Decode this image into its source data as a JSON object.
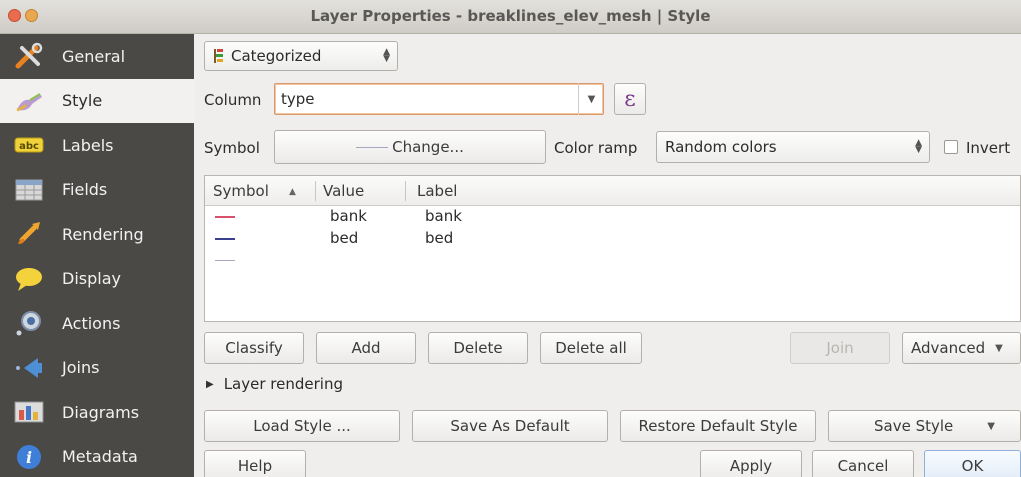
{
  "window": {
    "title": "Layer Properties - breaklines_elev_mesh | Style"
  },
  "sidebar": {
    "items": [
      {
        "label": "General",
        "icon": "tools-icon",
        "active": false
      },
      {
        "label": "Style",
        "icon": "paint-brush-icon",
        "active": true
      },
      {
        "label": "Labels",
        "icon": "abc-label-icon",
        "active": false
      },
      {
        "label": "Fields",
        "icon": "table-fields-icon",
        "active": false
      },
      {
        "label": "Rendering",
        "icon": "paintbrush-rendering-icon",
        "active": false
      },
      {
        "label": "Display",
        "icon": "speech-bubble-icon",
        "active": false
      },
      {
        "label": "Actions",
        "icon": "gear-actions-icon",
        "active": false
      },
      {
        "label": "Joins",
        "icon": "joins-arrow-icon",
        "active": false
      },
      {
        "label": "Diagrams",
        "icon": "diagrams-icon",
        "active": false
      },
      {
        "label": "Metadata",
        "icon": "info-icon",
        "active": false
      }
    ]
  },
  "renderer": {
    "selected": "Categorized"
  },
  "column": {
    "label": "Column",
    "value": "type"
  },
  "symbol": {
    "label": "Symbol",
    "change_label": "Change..."
  },
  "color_ramp": {
    "label": "Color ramp",
    "selected": "Random colors",
    "invert_label": "Invert"
  },
  "table": {
    "headers": {
      "symbol": "Symbol",
      "value": "Value",
      "label": "Label"
    },
    "rows": [
      {
        "value": "bank",
        "label": "bank",
        "color": "#d9526d"
      },
      {
        "value": "bed",
        "label": "bed",
        "color": "#3a3f8f"
      },
      {
        "value": "",
        "label": "",
        "color": "#a9a6c4"
      }
    ]
  },
  "actions": {
    "classify": "Classify",
    "add": "Add",
    "delete": "Delete",
    "delete_all": "Delete all",
    "join": "Join",
    "advanced": "Advanced"
  },
  "layer_rendering": {
    "label": "Layer rendering"
  },
  "style_buttons": {
    "load": "Load Style ...",
    "save_default": "Save As Default",
    "restore_default": "Restore Default Style",
    "save_style": "Save Style"
  },
  "dialog_buttons": {
    "help": "Help",
    "apply": "Apply",
    "cancel": "Cancel",
    "ok": "OK"
  }
}
